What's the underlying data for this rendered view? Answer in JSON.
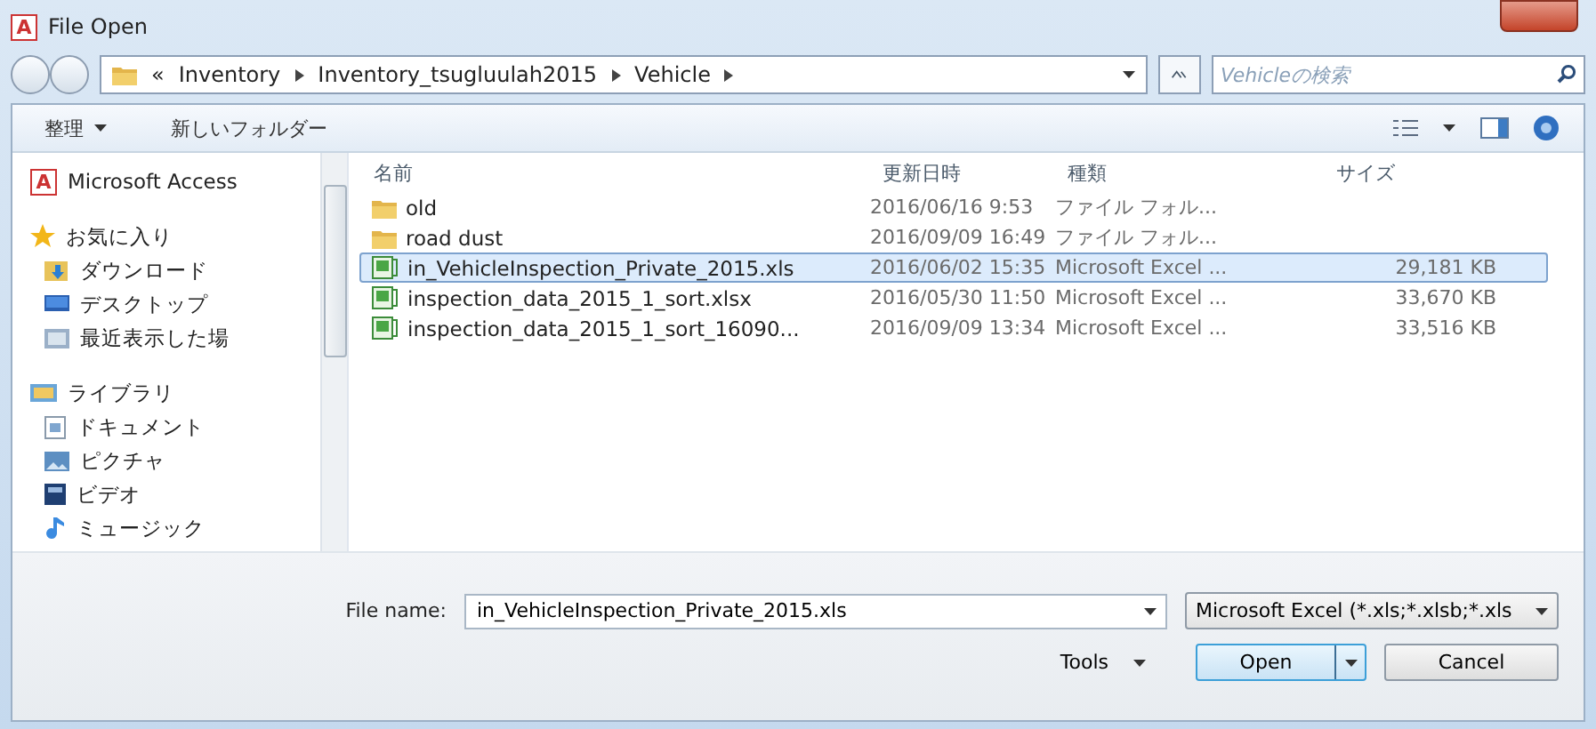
{
  "window": {
    "app_icon": "A",
    "title": "File Open"
  },
  "address_bar": {
    "overflow": "«",
    "path": [
      "Inventory",
      "Inventory_tsugluulah2015",
      "Vehicle"
    ]
  },
  "search": {
    "placeholder": "Vehicleの検索"
  },
  "toolbar": {
    "organize": "整理",
    "new_folder": "新しいフォルダー"
  },
  "sidebar": {
    "items": [
      {
        "kind": "app",
        "icon_text": "A",
        "label": "Microsoft Access"
      },
      {
        "kind": "group",
        "label": "お気に入り"
      },
      {
        "kind": "item",
        "label": "ダウンロード"
      },
      {
        "kind": "item",
        "label": "デスクトップ"
      },
      {
        "kind": "item",
        "label": "最近表示した場"
      },
      {
        "kind": "group",
        "label": "ライブラリ"
      },
      {
        "kind": "item",
        "label": "ドキュメント"
      },
      {
        "kind": "item",
        "label": "ピクチャ"
      },
      {
        "kind": "item",
        "label": "ビデオ"
      },
      {
        "kind": "item",
        "label": "ミュージック"
      }
    ]
  },
  "file_list": {
    "columns": [
      "名前",
      "更新日時",
      "種類",
      "サイズ"
    ],
    "rows": [
      {
        "kind": "folder",
        "name": "old",
        "modified": "2016/06/16 9:53",
        "type": "ファイル フォル...",
        "selected": false
      },
      {
        "kind": "folder",
        "name": "road dust",
        "modified": "2016/09/09 16:49",
        "type": "ファイル フォル...",
        "selected": false
      },
      {
        "kind": "excel",
        "name": "in_VehicleInspection_Private_2015.xls",
        "modified": "2016/06/02 15:35",
        "type": "Microsoft Excel ...",
        "size": "29,181 KB",
        "selected": true
      },
      {
        "kind": "excel",
        "name": "inspection_data_2015_1_sort.xlsx",
        "modified": "2016/05/30 11:50",
        "type": "Microsoft Excel ...",
        "size": "33,670 KB",
        "selected": false
      },
      {
        "kind": "excel",
        "name": "inspection_data_2015_1_sort_16090...",
        "modified": "2016/09/09 13:34",
        "type": "Microsoft Excel ...",
        "size": "33,516 KB",
        "selected": false
      }
    ]
  },
  "file_name": {
    "label": "File name:",
    "value": "in_VehicleInspection_Private_2015.xls"
  },
  "file_type": {
    "value": "Microsoft Excel (*.xls;*.xlsb;*.xls"
  },
  "buttons": {
    "tools": "Tools",
    "open": "Open",
    "cancel": "Cancel"
  }
}
